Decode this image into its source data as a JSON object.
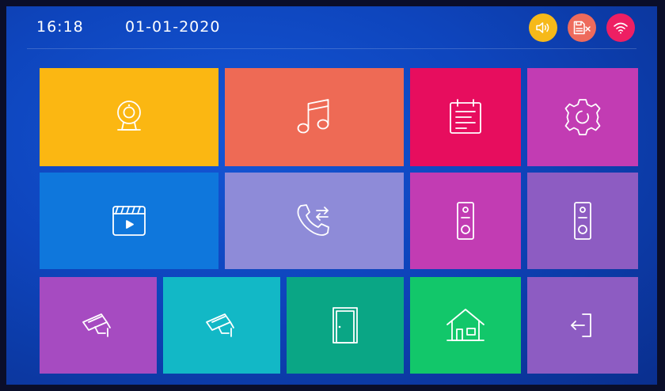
{
  "status_bar": {
    "time": "16:18",
    "date": "01-01-2020",
    "indicators": [
      {
        "name": "speaker-volume-icon",
        "color": "#f6b91a"
      },
      {
        "name": "sd-card-error-icon",
        "color": "#ee6b5c"
      },
      {
        "name": "wifi-icon",
        "color": "#ee1f63"
      }
    ]
  },
  "tiles": [
    {
      "id": "monitor",
      "icon": "webcam-icon",
      "color": "#fbb712"
    },
    {
      "id": "music",
      "icon": "music-note-icon",
      "color": "#ee6a55"
    },
    {
      "id": "notes",
      "icon": "notepad-icon",
      "color": "#e70d5e"
    },
    {
      "id": "settings",
      "icon": "gear-icon",
      "color": "#c23cb3"
    },
    {
      "id": "video-playback",
      "icon": "video-clapper-icon",
      "color": "#0f77dc"
    },
    {
      "id": "call-log",
      "icon": "phone-call-transfer-icon",
      "color": "#8e8bd8"
    },
    {
      "id": "door-station-1",
      "icon": "doorbell-icon",
      "color": "#c23cb3"
    },
    {
      "id": "door-station-2",
      "icon": "doorbell-icon",
      "color": "#8d5cc2"
    },
    {
      "id": "camera-1",
      "icon": "cctv-camera-icon",
      "color": "#a64bc1"
    },
    {
      "id": "camera-2",
      "icon": "cctv-camera-icon",
      "color": "#12b8c6"
    },
    {
      "id": "unlock-door",
      "icon": "door-icon",
      "color": "#0aa685"
    },
    {
      "id": "home-mode",
      "icon": "home-icon",
      "color": "#12c76a"
    },
    {
      "id": "exit",
      "icon": "logout-icon",
      "color": "#8d5cc2"
    }
  ]
}
